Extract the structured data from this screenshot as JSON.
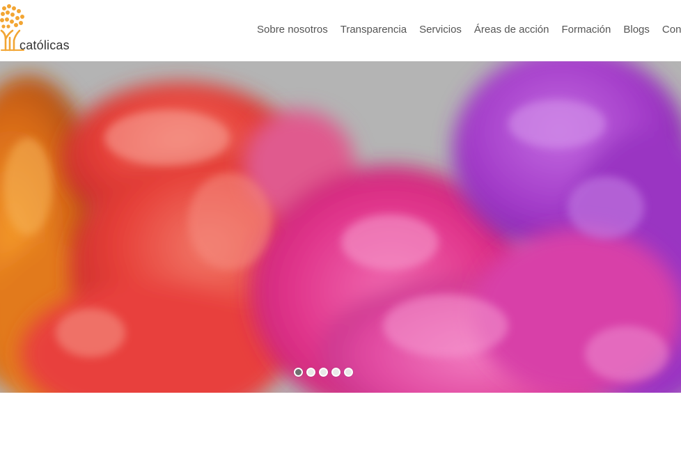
{
  "brand": {
    "logo_text": "católicas",
    "accent": "#f2a533"
  },
  "nav": {
    "items": [
      {
        "label": "Sobre nosotros"
      },
      {
        "label": "Transparencia"
      },
      {
        "label": "Servicios"
      },
      {
        "label": "Áreas de acción"
      },
      {
        "label": "Formación"
      },
      {
        "label": "Blogs"
      },
      {
        "label": "Cong"
      }
    ]
  },
  "hero": {
    "background": "#b4b4b4",
    "colors": [
      "#e27a1e",
      "#e8413c",
      "#e0337e",
      "#e455a8",
      "#a535c4"
    ],
    "slider": {
      "slide_count": 5,
      "active_index": 0
    }
  }
}
